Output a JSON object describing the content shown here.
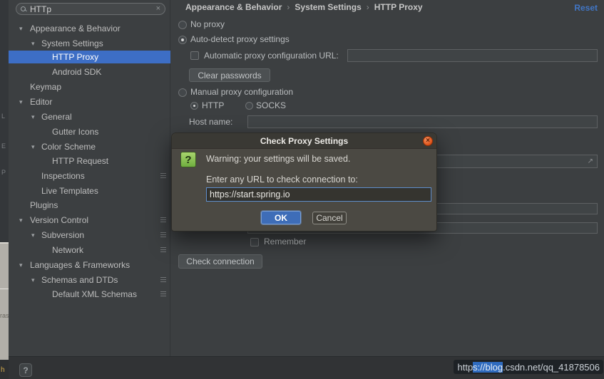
{
  "search": {
    "value": "HTTp"
  },
  "icons": {
    "collapse_arrow": "▾",
    "clear": "×",
    "close": "×",
    "expand": "↗",
    "question": "?"
  },
  "sidebar": {
    "items": [
      {
        "label": "Appearance & Behavior"
      },
      {
        "label": "System Settings"
      },
      {
        "label": "HTTP Proxy"
      },
      {
        "label": "Android SDK"
      },
      {
        "label": "Keymap"
      },
      {
        "label": "Editor"
      },
      {
        "label": "General"
      },
      {
        "label": "Gutter Icons"
      },
      {
        "label": "Color Scheme"
      },
      {
        "label": "HTTP Request"
      },
      {
        "label": "Inspections"
      },
      {
        "label": "Live Templates"
      },
      {
        "label": "Plugins"
      },
      {
        "label": "Version Control"
      },
      {
        "label": "Subversion"
      },
      {
        "label": "Network"
      },
      {
        "label": "Languages & Frameworks"
      },
      {
        "label": "Schemas and DTDs"
      },
      {
        "label": "Default XML Schemas"
      }
    ]
  },
  "breadcrumb": {
    "items": [
      "Appearance & Behavior",
      "System Settings",
      "HTTP Proxy"
    ],
    "separator": "›"
  },
  "actions": {
    "reset": "Reset",
    "clear_passwords": "Clear passwords",
    "check_connection": "Check connection",
    "ok": "OK",
    "cancel": "Cancel",
    "help": "?"
  },
  "proxy_form": {
    "no_proxy": "No proxy",
    "auto_detect": "Auto-detect proxy settings",
    "auto_url_label": "Automatic proxy configuration URL:",
    "manual": "Manual proxy configuration",
    "http": "HTTP",
    "socks": "SOCKS",
    "host_label": "Host name:",
    "remember": "Remember"
  },
  "dialog": {
    "title": "Check Proxy Settings",
    "warning": "Warning: your settings will be saved.",
    "prompt": "Enter any URL to check connection to:",
    "url_value": "https://start.spring.io"
  },
  "watermark": {
    "prefix": "http",
    "highlight": "s://blog",
    "suffix": ".csdn.net/qq_41878506"
  },
  "background_edge": {
    "glyph1": "L",
    "glyph2": "E",
    "glyph3": "P",
    "mid_text": "ras",
    "bottom_text": "h"
  }
}
